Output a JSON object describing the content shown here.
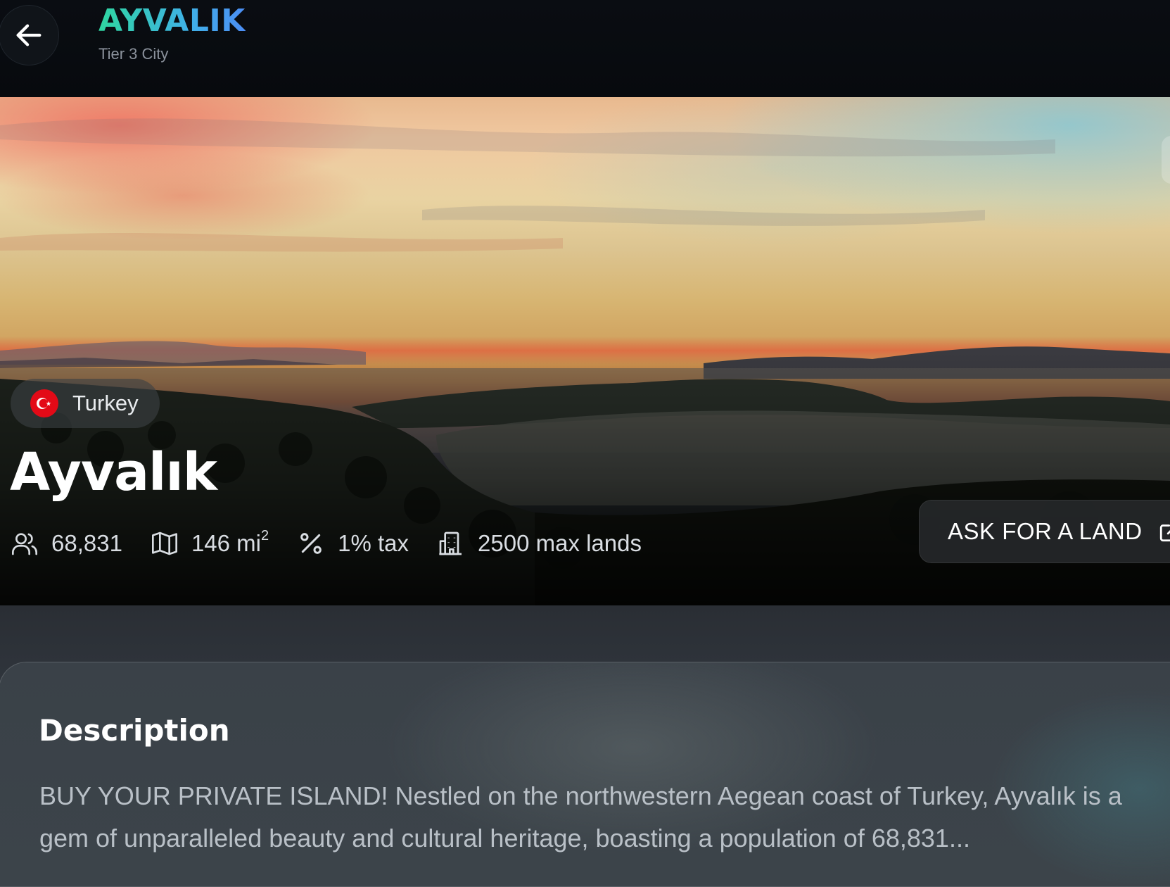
{
  "header": {
    "title": "AYVALIK",
    "subtitle": "Tier 3 City",
    "back_icon": "arrow-left-icon"
  },
  "hero": {
    "country": "Turkey",
    "flag_icon": "turkey-flag-icon",
    "city_name": "Ayvalık",
    "stats": {
      "population": "68,831",
      "area_value": "146 mi",
      "area_exponent": "2",
      "tax": "1% tax",
      "max_lands": "2500 max lands"
    },
    "ask_button": "ASK FOR A LAND",
    "ask_icon": "external-link-icon"
  },
  "description": {
    "title": "Description",
    "text": "BUY YOUR PRIVATE ISLAND! Nestled on the northwestern Aegean coast of Turkey, Ayvalık is a gem of unparalleled beauty and cultural heritage, boasting a population of 68,831..."
  },
  "colors": {
    "title_gradient_start": "#2fd6a0",
    "title_gradient_end": "#4c8ef5",
    "page_bg": "#05080c",
    "flag_red": "#e30a17"
  }
}
